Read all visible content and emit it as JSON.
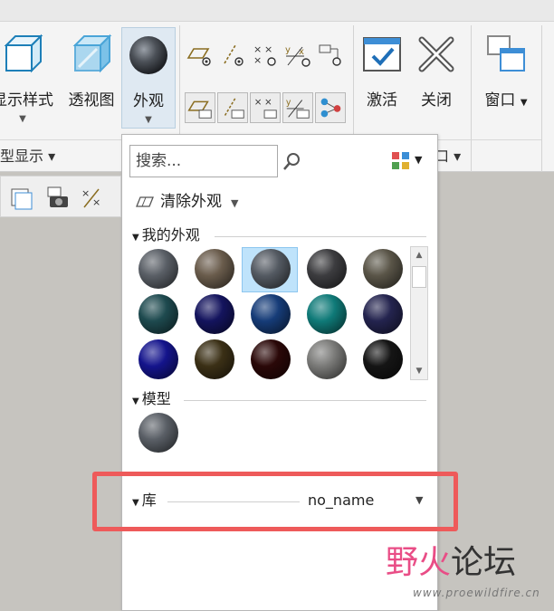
{
  "ribbon": {
    "buttons": {
      "display_style": "显示样式",
      "transparent_view": "透视图",
      "appearance": "外观",
      "activate": "激活",
      "close": "关闭",
      "window": "窗口"
    },
    "groups": {
      "model_display": "型显示 ▾",
      "window_group": "口 ▾"
    }
  },
  "panel": {
    "search_placeholder": "搜索...",
    "clear_appearance": "清除外观",
    "my_appearances": "我的外观",
    "model": "模型",
    "library": "库",
    "library_value": "no_name"
  },
  "swatch_colors": {
    "my": [
      "#5a5f66",
      "#6a5c4c",
      "#545a62",
      "#3c3c3f",
      "#5a5548",
      "#1e4a4f",
      "#14145e",
      "#163c78",
      "#0f7a78",
      "#24244f",
      "#14148c",
      "#3b3016",
      "#2a0808",
      "#7a7a78",
      "#151515"
    ],
    "model": [
      "#5a5f66"
    ]
  },
  "highlight_color": "#ee5a5a",
  "watermark": {
    "text_a": "野火",
    "text_b": "论坛",
    "url": "www.proewildfire.cn"
  }
}
